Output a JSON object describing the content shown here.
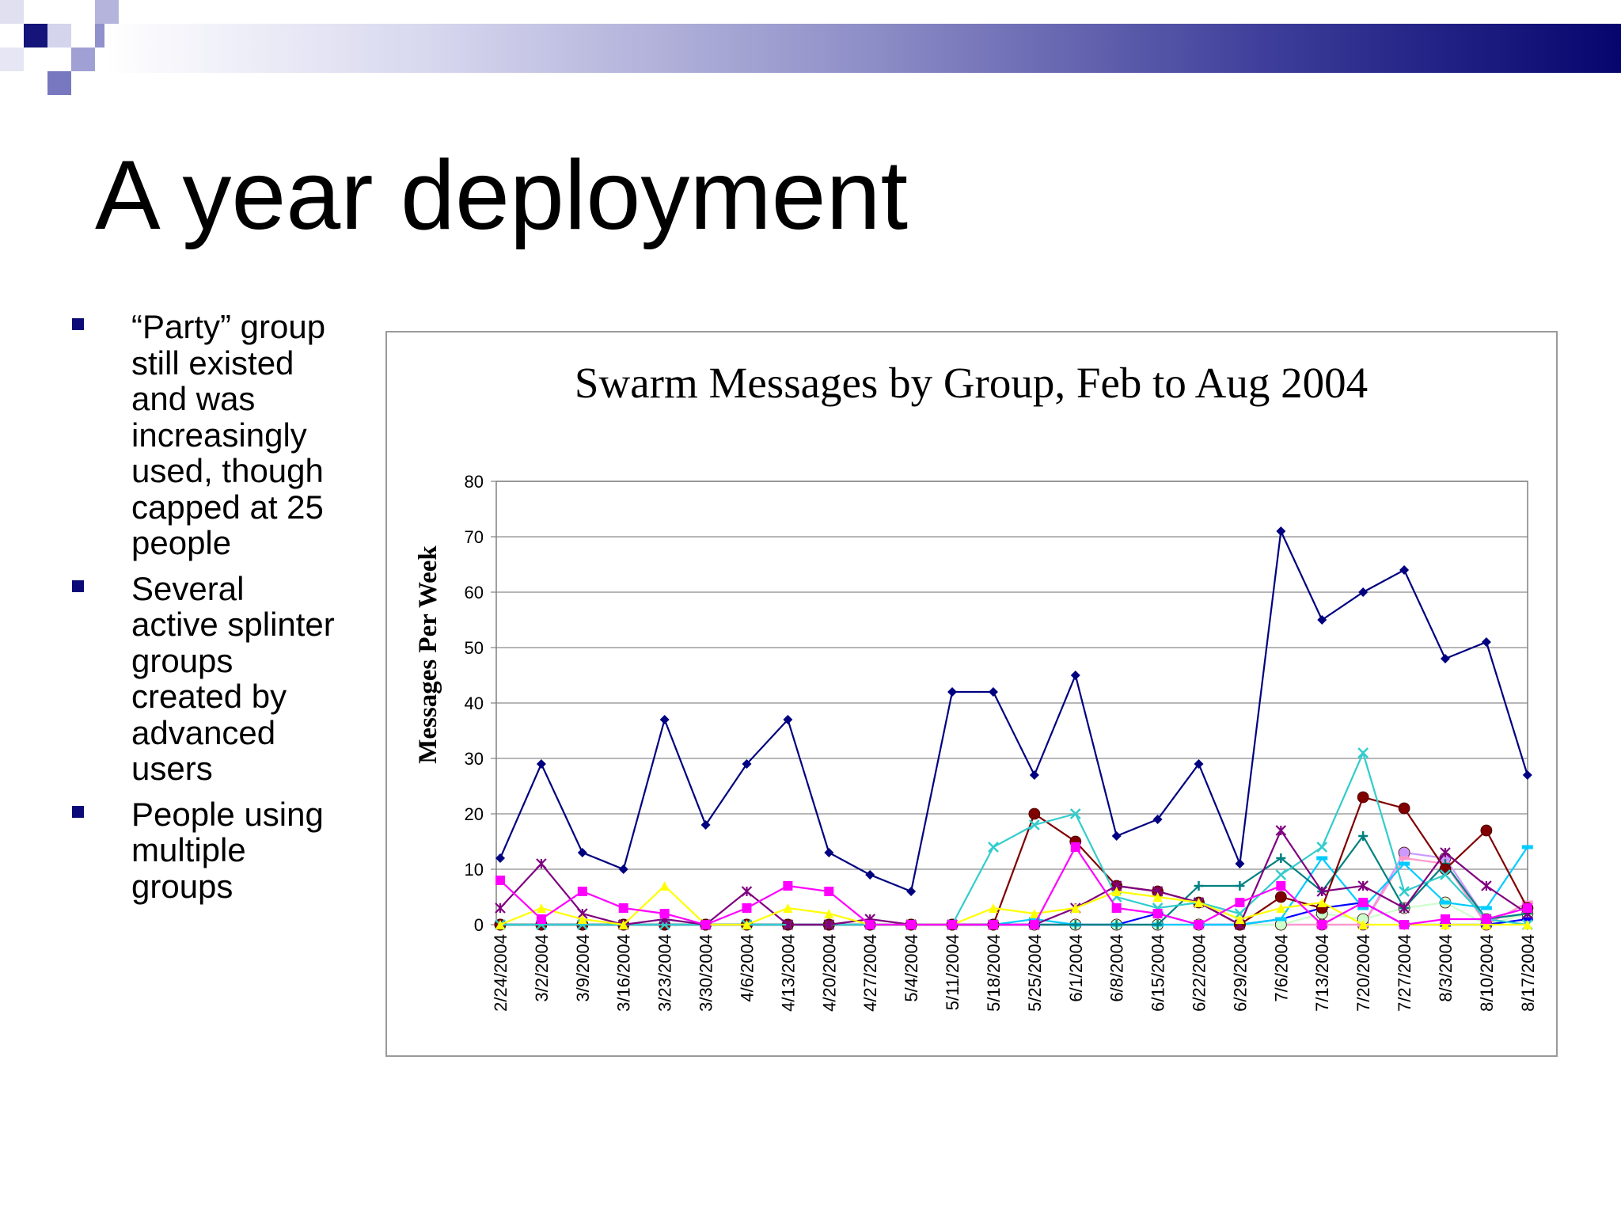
{
  "slide": {
    "title": "A year deployment",
    "bullets": [
      "“Party” group still existed and was increasingly used, though capped at 25 people",
      "Several active splinter groups created by advanced users",
      "People using multiple groups"
    ]
  },
  "colors": {
    "header_dark": "#05056e",
    "bullet": "#0a0a78",
    "deco_dark": "#14147a",
    "deco_mid": "#7878c0",
    "deco_light": "#b4b4dc"
  },
  "chart_data": {
    "type": "line",
    "title": "Swarm Messages by Group, Feb to Aug 2004",
    "xlabel": "",
    "ylabel": "Messages Per Week",
    "ylim": [
      0,
      80
    ],
    "yticks": [
      0,
      10,
      20,
      30,
      40,
      50,
      60,
      70,
      80
    ],
    "grid": true,
    "legend": "none",
    "categories": [
      "2/24/2004",
      "3/2/2004",
      "3/9/2004",
      "3/16/2004",
      "3/23/2004",
      "3/30/2004",
      "4/6/2004",
      "4/13/2004",
      "4/20/2004",
      "4/27/2004",
      "5/4/2004",
      "5/11/2004",
      "5/18/2004",
      "5/25/2004",
      "6/1/2004",
      "6/8/2004",
      "6/15/2004",
      "6/22/2004",
      "6/29/2004",
      "7/6/2004",
      "7/13/2004",
      "7/20/2004",
      "7/27/2004",
      "8/3/2004",
      "8/10/2004",
      "8/17/2004"
    ],
    "series": [
      {
        "color": "#000080",
        "marker": "diamond",
        "values": [
          12,
          29,
          13,
          10,
          37,
          18,
          29,
          37,
          13,
          9,
          6,
          42,
          42,
          27,
          45,
          16,
          19,
          29,
          11,
          71,
          55,
          60,
          64,
          48,
          51,
          27
        ]
      },
      {
        "color": "#ff00ff",
        "marker": "square",
        "values": [
          8,
          1,
          6,
          3,
          2,
          0,
          3,
          7,
          6,
          0,
          0,
          0,
          0,
          0,
          14,
          3,
          2,
          0,
          4,
          7,
          0,
          4,
          0,
          1,
          1,
          3
        ]
      },
      {
        "color": "#ffff00",
        "marker": "triangle",
        "values": [
          0,
          3,
          1,
          0,
          7,
          0,
          0,
          3,
          2,
          0,
          0,
          0,
          3,
          2,
          3,
          6,
          5,
          4,
          1,
          3,
          4,
          0,
          0,
          0,
          0,
          0
        ]
      },
      {
        "color": "#800080",
        "marker": "star",
        "values": [
          3,
          11,
          2,
          0,
          1,
          0,
          6,
          0,
          0,
          1,
          0,
          0,
          0,
          0,
          3,
          7,
          6,
          4,
          0,
          17,
          6,
          7,
          3,
          13,
          7,
          2
        ]
      },
      {
        "color": "#33cccc",
        "marker": "x",
        "values": [
          0,
          0,
          0,
          0,
          0,
          0,
          0,
          0,
          0,
          0,
          0,
          0,
          14,
          18,
          20,
          5,
          3,
          4,
          2,
          9,
          14,
          31,
          6,
          9,
          1,
          0
        ]
      },
      {
        "color": "#800000",
        "marker": "circle",
        "values": [
          0,
          0,
          0,
          0,
          0,
          0,
          0,
          0,
          0,
          0,
          0,
          0,
          0,
          20,
          15,
          7,
          6,
          4,
          0,
          5,
          3,
          23,
          21,
          10,
          17,
          3
        ]
      },
      {
        "color": "#008080",
        "marker": "plus",
        "values": [
          0,
          0,
          0,
          0,
          0,
          0,
          0,
          0,
          0,
          0,
          0,
          0,
          0,
          0,
          0,
          0,
          0,
          7,
          7,
          12,
          6,
          16,
          3,
          11,
          1,
          2
        ]
      },
      {
        "color": "#00ccff",
        "marker": "dash",
        "values": [
          0,
          0,
          0,
          0,
          0,
          0,
          0,
          0,
          0,
          0,
          0,
          0,
          0,
          1,
          0,
          0,
          0,
          0,
          0,
          1,
          12,
          3,
          11,
          4,
          3,
          14
        ]
      },
      {
        "color": "#0000ff",
        "marker": "dash",
        "values": [
          0,
          0,
          0,
          0,
          0,
          0,
          0,
          0,
          0,
          0,
          0,
          0,
          0,
          0,
          0,
          0,
          2,
          0,
          0,
          1,
          3,
          4,
          0,
          0,
          0,
          1
        ]
      },
      {
        "color": "#ccffcc",
        "marker": "circle",
        "values": [
          0,
          0,
          0,
          0,
          0,
          0,
          0,
          0,
          0,
          0,
          0,
          0,
          0,
          0,
          0,
          0,
          0,
          0,
          0,
          0,
          2,
          1,
          3,
          4,
          0,
          2
        ]
      },
      {
        "color": "#ff99cc",
        "marker": "dash",
        "values": [
          0,
          0,
          0,
          0,
          0,
          0,
          0,
          0,
          0,
          0,
          0,
          0,
          0,
          0,
          0,
          0,
          0,
          0,
          0,
          0,
          0,
          0,
          12,
          11,
          0,
          4
        ]
      },
      {
        "color": "#cc99ff",
        "marker": "circle",
        "values": [
          0,
          0,
          0,
          0,
          0,
          0,
          0,
          0,
          0,
          0,
          0,
          0,
          0,
          0,
          0,
          0,
          0,
          0,
          0,
          0,
          0,
          0,
          13,
          12,
          1,
          3
        ]
      }
    ]
  }
}
